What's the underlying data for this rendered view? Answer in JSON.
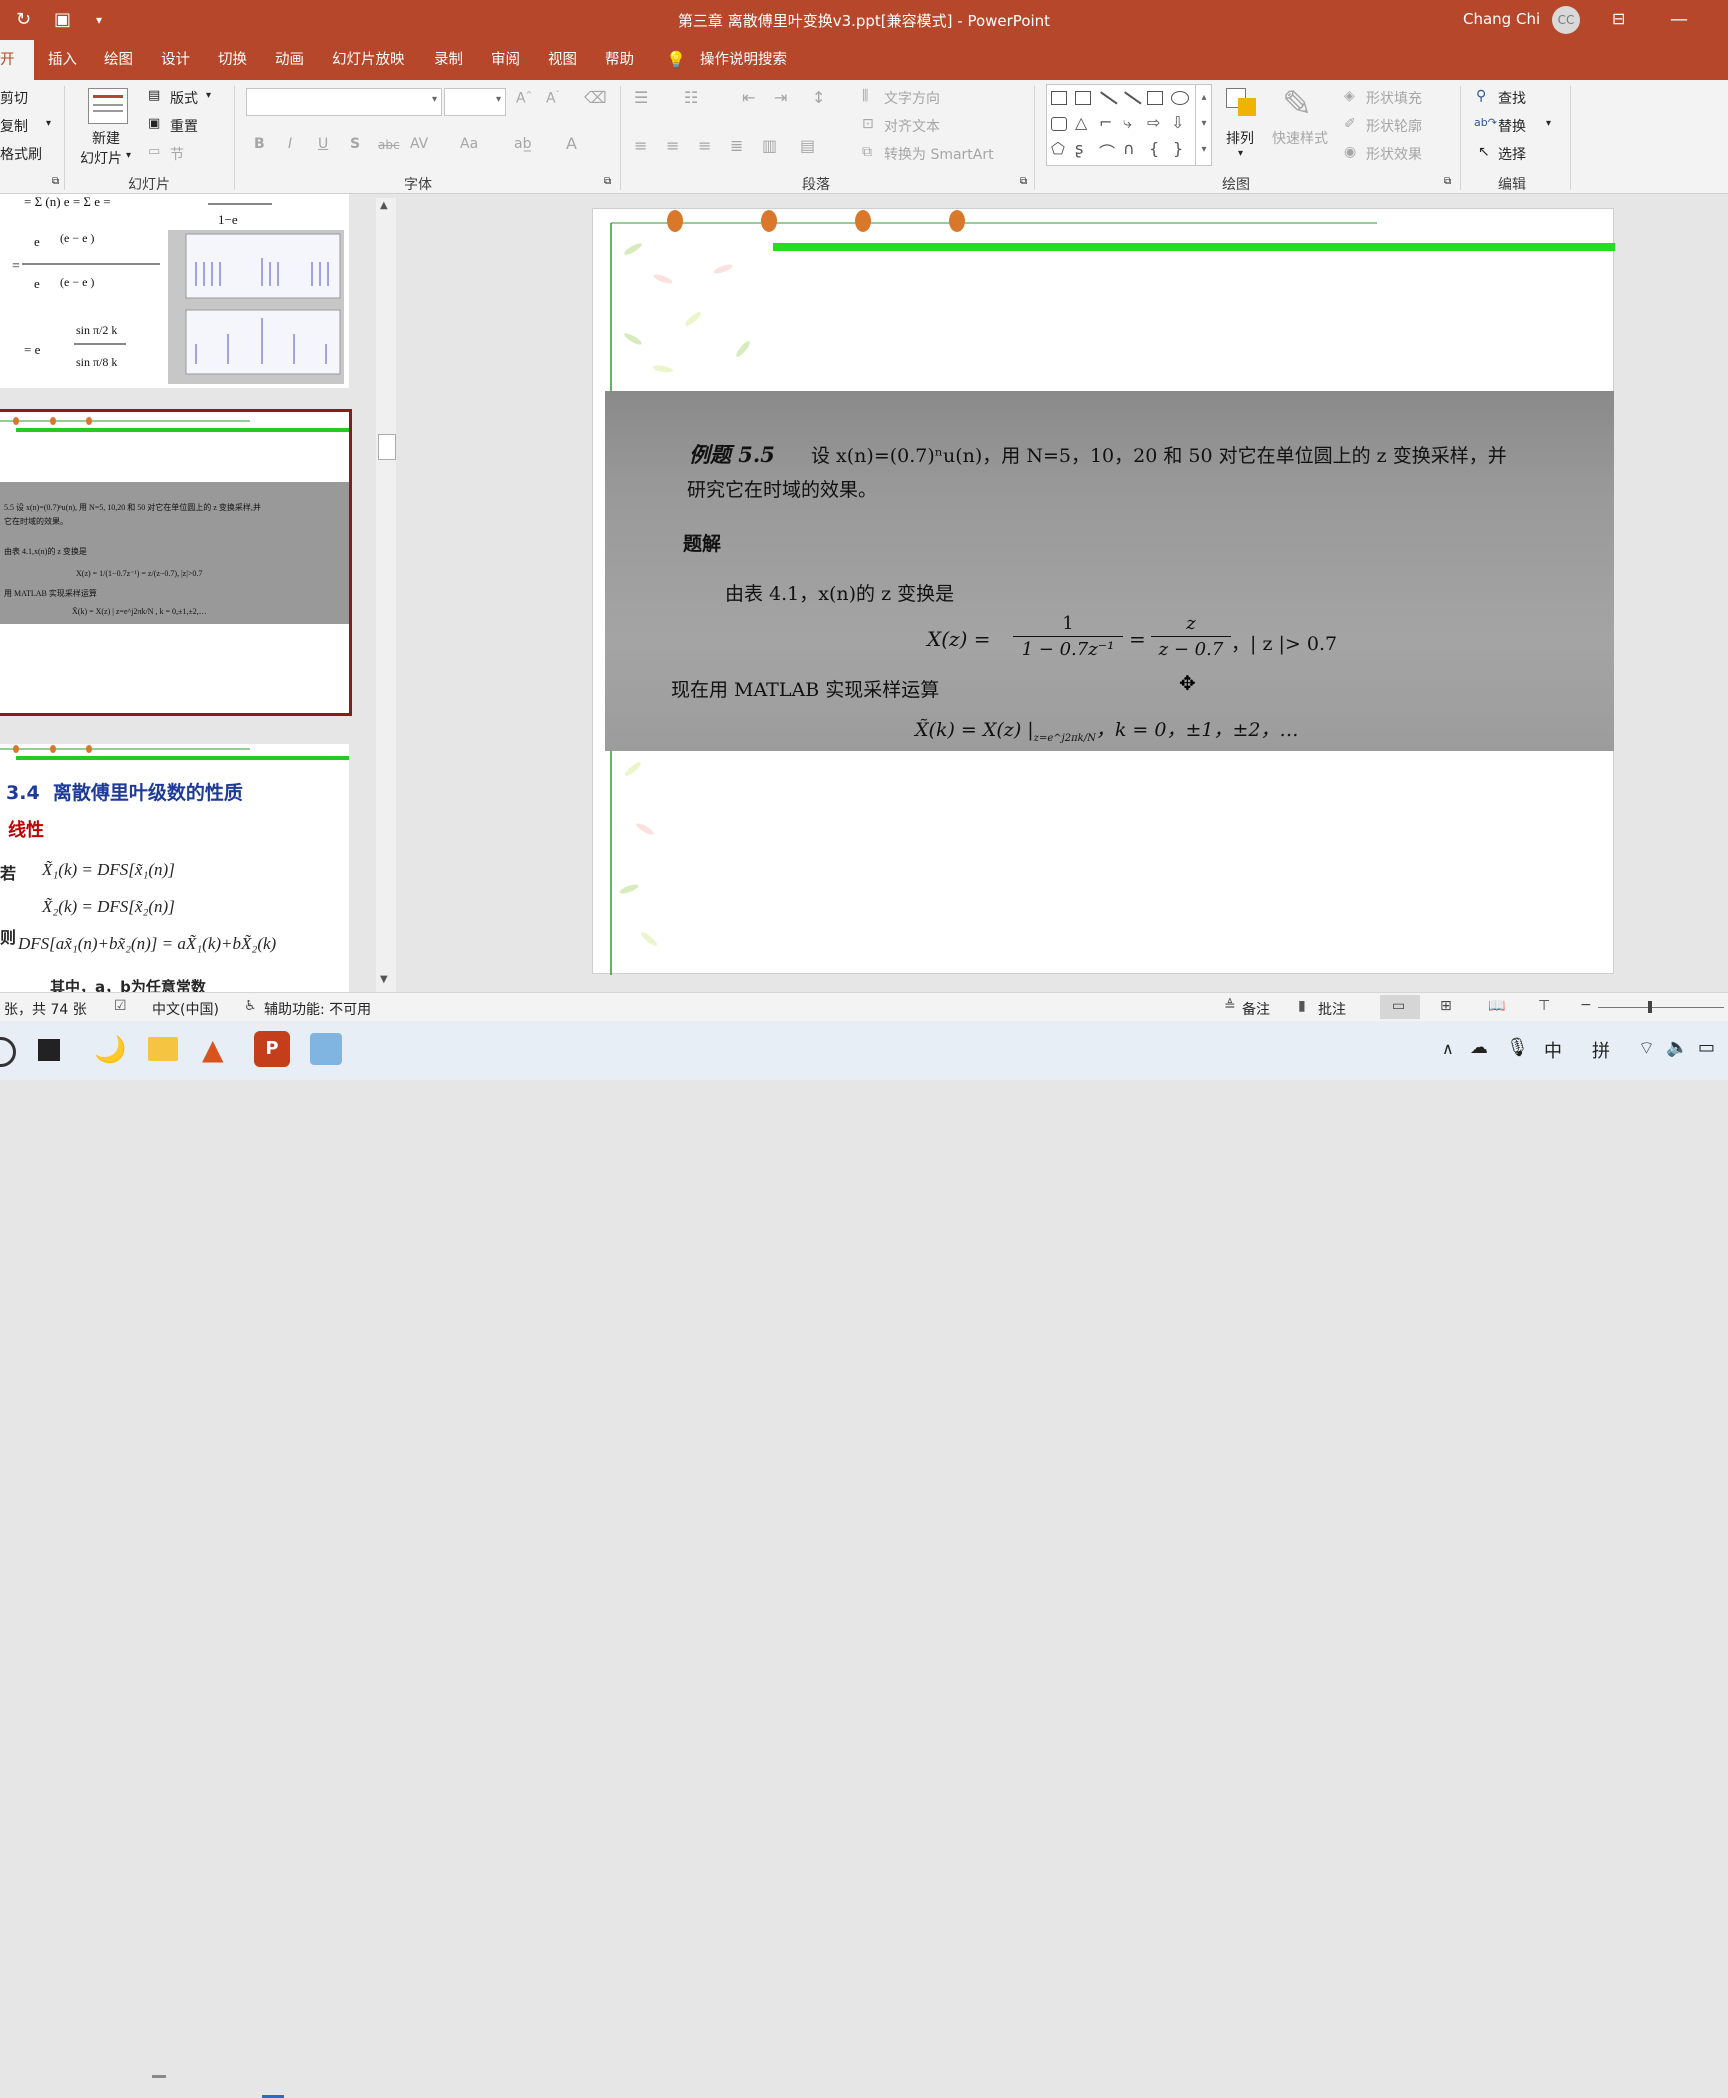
{
  "window": {
    "title": "第三章 离散傅里叶变换v3.ppt[兼容模式] - PowerPoint",
    "user_name": "Chang Chi",
    "user_initials": "CC"
  },
  "tabs": [
    "开始",
    "插入",
    "绘图",
    "设计",
    "切换",
    "动画",
    "幻灯片放映",
    "录制",
    "审阅",
    "视图",
    "帮助",
    "操作说明搜索"
  ],
  "ribbon": {
    "clipboard": {
      "cut": "剪切",
      "copy": "复制",
      "format_painter": "格式刷"
    },
    "slides": {
      "new_slide_line1": "新建",
      "new_slide_line2": "幻灯片",
      "layout": "版式",
      "reset": "重置",
      "section": "节",
      "label": "幻灯片"
    },
    "font": {
      "label": "字体",
      "bold": "B",
      "italic": "I",
      "underline": "U",
      "shadow": "S",
      "strike": "abc",
      "spacing": "AV",
      "case": "Aa"
    },
    "paragraph": {
      "text_direction": "文字方向",
      "align_text": "对齐文本",
      "smartart": "转换为 SmartArt",
      "label": "段落"
    },
    "drawing": {
      "arrange": "排列",
      "quick_styles": "快速样式",
      "shape_fill": "形状填充",
      "shape_outline": "形状轮廓",
      "shape_effects": "形状效果",
      "label": "绘图"
    },
    "editing": {
      "find": "查找",
      "replace": "替换",
      "select": "选择",
      "label": "编辑"
    }
  },
  "thumbnails": {
    "slide3": {
      "title_num": "3.4",
      "title": "离散傅里叶级数的性质",
      "subtitle": "线性",
      "if_label": "若",
      "then_label": "则",
      "eq1": "X̃₁(k) = DFS[x̃₁(n)]",
      "eq2": "X̃₂(k) = DFS[x̃₂(n)]",
      "eq3": "DFS[ax̃₁(n)+bx̃₂(n)] = aX̃₁(k)+bX̃₂(k)",
      "footer": "其中，a，b为任意常数"
    }
  },
  "slide": {
    "example_title": "例题 5.5",
    "problem_line1": "设 x(n)=(0.7)ⁿu(n)，用 N=5，10，20 和 50 对它在单位圆上的 z 变换采样，并",
    "problem_line2": "研究它在时域的效果。",
    "solution_label": "题解",
    "line_a": "由表 4.1，x(n)的 z 变换是",
    "formula_lhs": "X(z) =",
    "frac1_num": "1",
    "frac1_den": "1 − 0.7z⁻¹",
    "frac2_num": "z",
    "frac2_den": "z − 0.7",
    "condition": "，| z |> 0.7",
    "line_b": "现在用 MATLAB 实现采样运算",
    "formula2": "X̃(k) = X(z) |",
    "formula2_sub": "z=e^j2πk/N",
    "formula2_tail": "，k = 0，±1，±2，…"
  },
  "status": {
    "slide_count": "张，共 74 张",
    "language": "中文(中国)",
    "accessibility": "辅助功能: 不可用",
    "notes": "备注",
    "comments": "批注"
  },
  "taskbar": {
    "ime_mode": "中",
    "ime_pinyin": "拼"
  }
}
